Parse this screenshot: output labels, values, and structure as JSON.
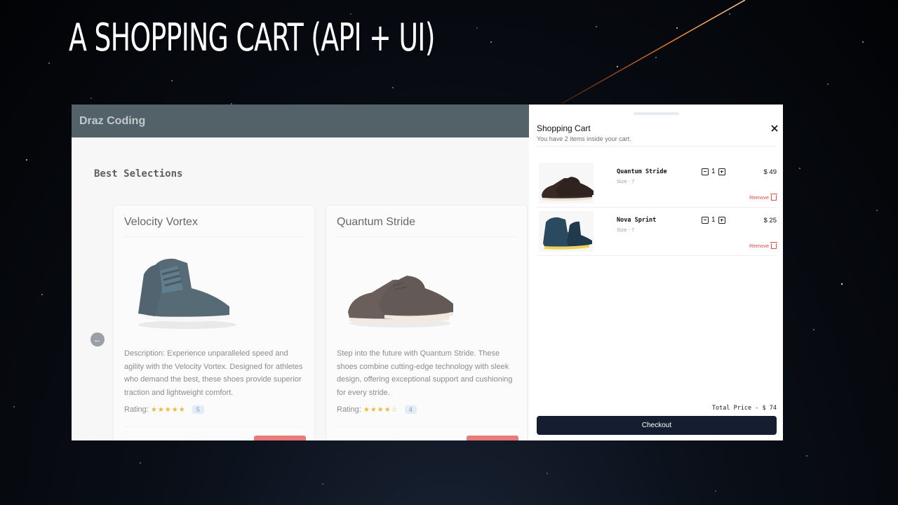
{
  "slide": {
    "title": "A SHOPPING CART (API + UI)"
  },
  "app": {
    "brand": "Draz Coding",
    "section_title": "Best Selections",
    "products": [
      {
        "name": "Velocity Vortex",
        "description": "Description: Experience unparalleled speed and agility with the Velocity Vortex. Designed for athletes who demand the best, these shoes provide superior traction and lightweight comfort.",
        "rating_label": "Rating:",
        "stars": "★★★★★",
        "rating": "5"
      },
      {
        "name": "Quantum Stride",
        "description": "Step into the future with Quantum Stride. These shoes combine cutting-edge technology with sleek design, offering exceptional support and cushioning for every stride.",
        "rating_label": "Rating:",
        "stars": "★★★★☆",
        "rating": "4"
      }
    ]
  },
  "cart": {
    "title": "Shopping Cart",
    "subtitle": "You have 2 items inside your cart.",
    "items": [
      {
        "name": "Quantum Stride",
        "size": "Size - 7",
        "qty": "1",
        "price": "$ 49",
        "remove_label": "Remove"
      },
      {
        "name": "Nova Sprint",
        "size": "Size - 7",
        "qty": "1",
        "price": "$ 25",
        "remove_label": "Remove"
      }
    ],
    "total": "Total Price - $ 74",
    "checkout_label": "Checkout"
  }
}
